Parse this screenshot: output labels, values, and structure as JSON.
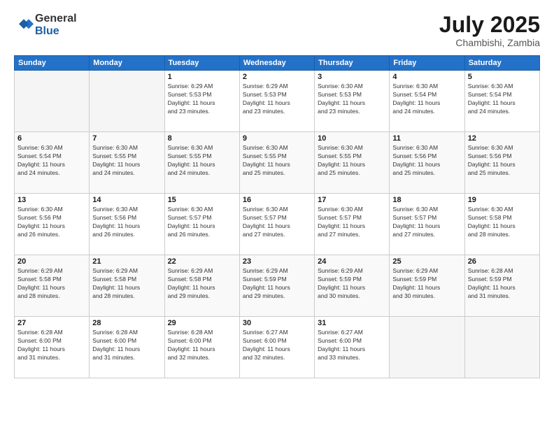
{
  "logo": {
    "general": "General",
    "blue": "Blue"
  },
  "title": "July 2025",
  "location": "Chambishi, Zambia",
  "days_header": [
    "Sunday",
    "Monday",
    "Tuesday",
    "Wednesday",
    "Thursday",
    "Friday",
    "Saturday"
  ],
  "weeks": [
    [
      {
        "day": "",
        "info": ""
      },
      {
        "day": "",
        "info": ""
      },
      {
        "day": "1",
        "info": "Sunrise: 6:29 AM\nSunset: 5:53 PM\nDaylight: 11 hours\nand 23 minutes."
      },
      {
        "day": "2",
        "info": "Sunrise: 6:29 AM\nSunset: 5:53 PM\nDaylight: 11 hours\nand 23 minutes."
      },
      {
        "day": "3",
        "info": "Sunrise: 6:30 AM\nSunset: 5:53 PM\nDaylight: 11 hours\nand 23 minutes."
      },
      {
        "day": "4",
        "info": "Sunrise: 6:30 AM\nSunset: 5:54 PM\nDaylight: 11 hours\nand 24 minutes."
      },
      {
        "day": "5",
        "info": "Sunrise: 6:30 AM\nSunset: 5:54 PM\nDaylight: 11 hours\nand 24 minutes."
      }
    ],
    [
      {
        "day": "6",
        "info": "Sunrise: 6:30 AM\nSunset: 5:54 PM\nDaylight: 11 hours\nand 24 minutes."
      },
      {
        "day": "7",
        "info": "Sunrise: 6:30 AM\nSunset: 5:55 PM\nDaylight: 11 hours\nand 24 minutes."
      },
      {
        "day": "8",
        "info": "Sunrise: 6:30 AM\nSunset: 5:55 PM\nDaylight: 11 hours\nand 24 minutes."
      },
      {
        "day": "9",
        "info": "Sunrise: 6:30 AM\nSunset: 5:55 PM\nDaylight: 11 hours\nand 25 minutes."
      },
      {
        "day": "10",
        "info": "Sunrise: 6:30 AM\nSunset: 5:55 PM\nDaylight: 11 hours\nand 25 minutes."
      },
      {
        "day": "11",
        "info": "Sunrise: 6:30 AM\nSunset: 5:56 PM\nDaylight: 11 hours\nand 25 minutes."
      },
      {
        "day": "12",
        "info": "Sunrise: 6:30 AM\nSunset: 5:56 PM\nDaylight: 11 hours\nand 25 minutes."
      }
    ],
    [
      {
        "day": "13",
        "info": "Sunrise: 6:30 AM\nSunset: 5:56 PM\nDaylight: 11 hours\nand 26 minutes."
      },
      {
        "day": "14",
        "info": "Sunrise: 6:30 AM\nSunset: 5:56 PM\nDaylight: 11 hours\nand 26 minutes."
      },
      {
        "day": "15",
        "info": "Sunrise: 6:30 AM\nSunset: 5:57 PM\nDaylight: 11 hours\nand 26 minutes."
      },
      {
        "day": "16",
        "info": "Sunrise: 6:30 AM\nSunset: 5:57 PM\nDaylight: 11 hours\nand 27 minutes."
      },
      {
        "day": "17",
        "info": "Sunrise: 6:30 AM\nSunset: 5:57 PM\nDaylight: 11 hours\nand 27 minutes."
      },
      {
        "day": "18",
        "info": "Sunrise: 6:30 AM\nSunset: 5:57 PM\nDaylight: 11 hours\nand 27 minutes."
      },
      {
        "day": "19",
        "info": "Sunrise: 6:30 AM\nSunset: 5:58 PM\nDaylight: 11 hours\nand 28 minutes."
      }
    ],
    [
      {
        "day": "20",
        "info": "Sunrise: 6:29 AM\nSunset: 5:58 PM\nDaylight: 11 hours\nand 28 minutes."
      },
      {
        "day": "21",
        "info": "Sunrise: 6:29 AM\nSunset: 5:58 PM\nDaylight: 11 hours\nand 28 minutes."
      },
      {
        "day": "22",
        "info": "Sunrise: 6:29 AM\nSunset: 5:58 PM\nDaylight: 11 hours\nand 29 minutes."
      },
      {
        "day": "23",
        "info": "Sunrise: 6:29 AM\nSunset: 5:59 PM\nDaylight: 11 hours\nand 29 minutes."
      },
      {
        "day": "24",
        "info": "Sunrise: 6:29 AM\nSunset: 5:59 PM\nDaylight: 11 hours\nand 30 minutes."
      },
      {
        "day": "25",
        "info": "Sunrise: 6:29 AM\nSunset: 5:59 PM\nDaylight: 11 hours\nand 30 minutes."
      },
      {
        "day": "26",
        "info": "Sunrise: 6:28 AM\nSunset: 5:59 PM\nDaylight: 11 hours\nand 31 minutes."
      }
    ],
    [
      {
        "day": "27",
        "info": "Sunrise: 6:28 AM\nSunset: 6:00 PM\nDaylight: 11 hours\nand 31 minutes."
      },
      {
        "day": "28",
        "info": "Sunrise: 6:28 AM\nSunset: 6:00 PM\nDaylight: 11 hours\nand 31 minutes."
      },
      {
        "day": "29",
        "info": "Sunrise: 6:28 AM\nSunset: 6:00 PM\nDaylight: 11 hours\nand 32 minutes."
      },
      {
        "day": "30",
        "info": "Sunrise: 6:27 AM\nSunset: 6:00 PM\nDaylight: 11 hours\nand 32 minutes."
      },
      {
        "day": "31",
        "info": "Sunrise: 6:27 AM\nSunset: 6:00 PM\nDaylight: 11 hours\nand 33 minutes."
      },
      {
        "day": "",
        "info": ""
      },
      {
        "day": "",
        "info": ""
      }
    ]
  ]
}
